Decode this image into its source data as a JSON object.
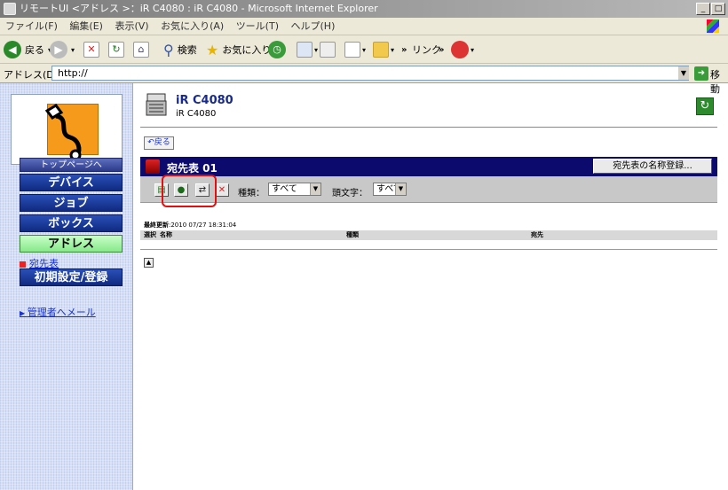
{
  "window": {
    "title": "リモートUI <アドレス >：iR C4080 : iR C4080 - Microsoft Internet Explorer"
  },
  "menu": [
    "ファイル(F)",
    "編集(E)",
    "表示(V)",
    "お気に入り(A)",
    "ツール(T)",
    "ヘルプ(H)"
  ],
  "toolbar": {
    "back": "戻る",
    "search": "検索",
    "favorites": "お気に入り",
    "links": "リンク"
  },
  "address": {
    "label": "アドレス(D)",
    "value": "http://",
    "go": "移動"
  },
  "sidebar": {
    "top_button": "トップページへ",
    "nav": [
      "デバイス",
      "ジョブ",
      "ボックス",
      "アドレス"
    ],
    "sub_item": "宛先表",
    "settings": "初期設定/登録",
    "mail_link": "管理者へメール"
  },
  "device": {
    "name": "iR C4080",
    "model": "iR C4080"
  },
  "main": {
    "back_label": "戻る",
    "panel_title": "宛先表 01",
    "register_name_button": "宛先表の名称登録...",
    "kind_label": "種類：",
    "kind_value": "すべて",
    "head_char_label": "頭文字：",
    "head_char_value": "すべて",
    "last_updated_label": "最終更新",
    "last_updated_value": ":2010 07/27 18:31:04",
    "columns": [
      "選択",
      "名称",
      "種類",
      "宛先"
    ]
  }
}
